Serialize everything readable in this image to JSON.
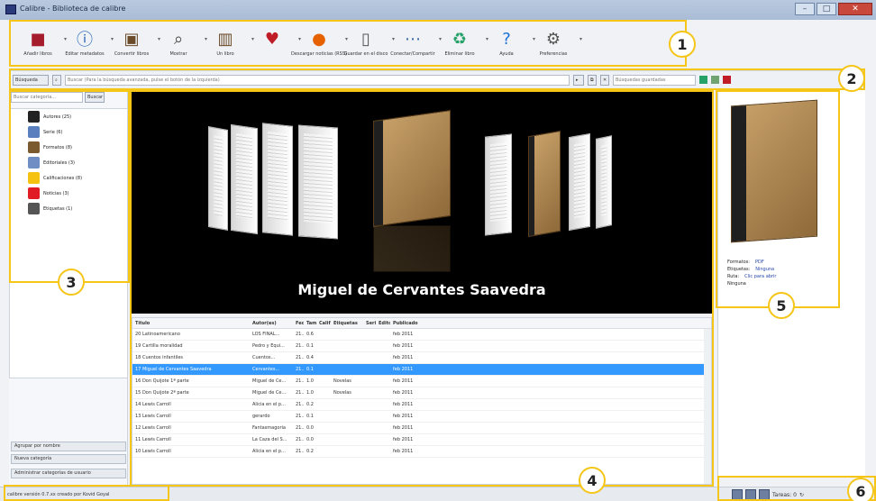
{
  "window": {
    "title": "Calibre - Biblioteca de calibre"
  },
  "toolbar": [
    {
      "label": "Añadir libros",
      "icon": "add-book-icon",
      "color": "#a51d2d"
    },
    {
      "label": "Editar metadatos",
      "icon": "info-icon",
      "color": "#1a5fb4"
    },
    {
      "label": "Convertir libros",
      "icon": "convert-icon",
      "color": "#6b4b2a"
    },
    {
      "label": "Mostrar",
      "icon": "magnifier-icon",
      "color": "#444"
    },
    {
      "label": "Un libro",
      "icon": "library-icon",
      "color": "#6b4b2a"
    },
    {
      "label": "",
      "icon": "heart-icon",
      "color": "#c01c28"
    },
    {
      "label": "Descargar noticias (RSS)",
      "icon": "news-icon",
      "color": "#e66100"
    },
    {
      "label": "Guardar en el disco",
      "icon": "device-icon",
      "color": "#555"
    },
    {
      "label": "Conectar/Compartir",
      "icon": "share-icon",
      "color": "#3d6aa6"
    },
    {
      "label": "Eliminar libro",
      "icon": "recycle-icon",
      "color": "#26a269"
    },
    {
      "label": "Ayuda",
      "icon": "help-icon",
      "color": "#1c71d8"
    },
    {
      "label": "Preferencias",
      "icon": "gear-icon",
      "color": "#555"
    }
  ],
  "searchbar": {
    "search_label": "Búsqueda",
    "search_placeholder": "Buscar (Para la búsqueda avanzada, pulse el botón de la izquierda)",
    "saved_placeholder": "Búsquedas guardadas"
  },
  "sidebar": {
    "filter_placeholder": "Buscar categoría...",
    "find_label": "Buscar",
    "items": [
      {
        "label": "Autores (25)",
        "icon": "person-icon",
        "color": "#222"
      },
      {
        "label": "Serie (6)",
        "icon": "series-icon",
        "color": "#5a7fbf"
      },
      {
        "label": "Formatos (8)",
        "icon": "formats-icon",
        "color": "#7a5a2e"
      },
      {
        "label": "Editoriales (3)",
        "icon": "publisher-icon",
        "color": "#6f8ec4"
      },
      {
        "label": "Calificaciones (8)",
        "icon": "star-icon",
        "color": "#f5c211"
      },
      {
        "label": "Noticias (3)",
        "icon": "news-icon",
        "color": "#e01b24"
      },
      {
        "label": "Etiquetas (1)",
        "icon": "tag-icon",
        "color": "#555"
      }
    ],
    "btn_group": "Agrupar por nombre",
    "btn_new": "Nueva categoría",
    "btn_manage": "Administrar categorías de usuario"
  },
  "cover": {
    "title": "Miguel de Cervantes Saavedra"
  },
  "table": {
    "columns": [
      "Título",
      "Autor(es)",
      "Fecha",
      "Tam.",
      "Calif.",
      "Etiquetas",
      "Serie",
      "Editorial",
      "Publicado"
    ],
    "rows": [
      [
        "20 Latinoamericano",
        "LOS FINAL...",
        "21...",
        "0.6",
        "",
        "",
        "",
        "",
        "feb 2011"
      ],
      [
        "19 Cartilla moralidad",
        "Pedro y Equi...",
        "21...",
        "0.1",
        "",
        "",
        "",
        "",
        "feb 2011"
      ],
      [
        "18 Cuentos infantiles",
        "Cuentos...",
        "21...",
        "0.4",
        "",
        "",
        "",
        "",
        "feb 2011"
      ],
      [
        "17 Miguel de Cervantes Saavedra",
        "Cervantes...",
        "21...",
        "0.1",
        "",
        "",
        "",
        "",
        "feb 2011"
      ],
      [
        "16 Don Quijote 1ª parte",
        "Miguel de Ce...",
        "21...",
        "1.0",
        "",
        "Novelas",
        "",
        "",
        "feb 2011"
      ],
      [
        "15 Don Quijote 2ª parte",
        "Miguel de Ce...",
        "21...",
        "1.0",
        "",
        "Novelas",
        "",
        "",
        "feb 2011"
      ],
      [
        "14 Lewis Carroll",
        "Alicia en el p...",
        "21...",
        "0.2",
        "",
        "",
        "",
        "",
        "feb 2011"
      ],
      [
        "13 Lewis Carroll",
        "gerardo",
        "21...",
        "0.1",
        "",
        "",
        "",
        "",
        "feb 2011"
      ],
      [
        "12 Lewis Carroll",
        "Fantasmagoría",
        "21...",
        "0.0",
        "",
        "",
        "",
        "",
        "feb 2011"
      ],
      [
        "11 Lewis Carroll",
        "La Caza del S...",
        "21...",
        "0.0",
        "",
        "",
        "",
        "",
        "feb 2011"
      ],
      [
        "10 Lewis Carroll",
        "Alicia en el p...",
        "21...",
        "0.2",
        "",
        "",
        "",
        "",
        "feb 2011"
      ]
    ]
  },
  "details": [
    {
      "k": "Formatos:",
      "v": "PDF"
    },
    {
      "k": "Etiquetas:",
      "v": "Ninguna"
    },
    {
      "k": "Ruta:",
      "v": "Clic para abrir"
    },
    {
      "k": "Ninguna",
      "v": ""
    }
  ],
  "status": {
    "text": "calibre versión 0.7.xx creado por Kovid Goyal",
    "jobs": "Tareas: 0"
  },
  "callouts": [
    "1",
    "2",
    "3",
    "4",
    "5",
    "6"
  ]
}
